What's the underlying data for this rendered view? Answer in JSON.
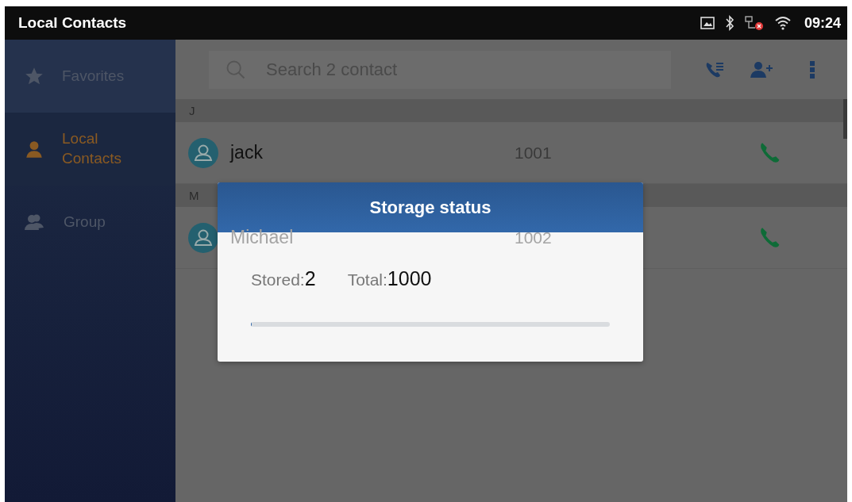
{
  "status_bar": {
    "title": "Local Contacts",
    "time": "09:24"
  },
  "sidebar": {
    "items": [
      {
        "label": "Favorites",
        "kind": "star",
        "selected": false
      },
      {
        "label": "Local Contacts",
        "kind": "person",
        "selected": true
      },
      {
        "label": "Group",
        "kind": "group",
        "selected": false
      }
    ]
  },
  "search": {
    "placeholder": "Search 2 contact"
  },
  "contacts": [
    {
      "letter": "J",
      "entries": [
        {
          "name": "jack",
          "number": "1001"
        }
      ]
    },
    {
      "letter": "M",
      "entries": [
        {
          "name": "Michael",
          "number": "1002"
        }
      ]
    }
  ],
  "dialog": {
    "title": "Storage status",
    "stored_label": "Stored:",
    "stored": "2",
    "total_label": "Total:",
    "total": "1000",
    "level": 0.002
  }
}
